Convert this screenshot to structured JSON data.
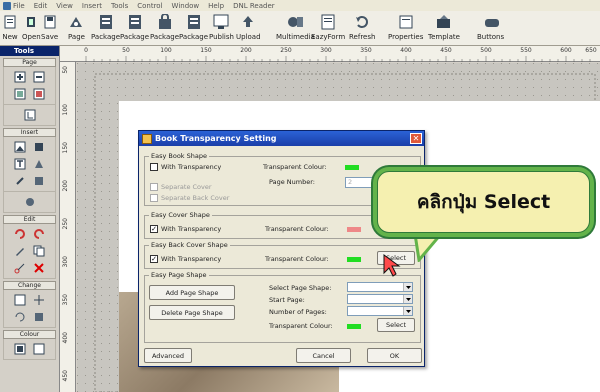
{
  "menu": [
    "File",
    "Edit",
    "View",
    "Insert",
    "Tools",
    "Control",
    "Window",
    "Help",
    "DNL Reader"
  ],
  "toolbar": {
    "items": [
      "New",
      "Open",
      "Save",
      "Page",
      "Package",
      "Package",
      "Package",
      "Package",
      "Publish",
      "Upload",
      "Multimedia",
      "EazyForm",
      "Refresh",
      "Properties",
      "Template",
      "Buttons"
    ]
  },
  "tool_panel": {
    "header": "Tools",
    "sections": [
      "Page",
      "Insert",
      "Edit",
      "Change",
      "Colour"
    ]
  },
  "ruler": {
    "top": [
      "0",
      "50",
      "100",
      "150",
      "200",
      "250",
      "300",
      "350",
      "400",
      "450",
      "500",
      "550",
      "600",
      "650"
    ],
    "left": [
      "50",
      "100",
      "150",
      "200",
      "250",
      "300",
      "350",
      "400",
      "450"
    ]
  },
  "dialog": {
    "title": "Book Transparency Setting",
    "easy_book_shape": {
      "title": "Easy Book Shape",
      "with_transparency": "With Transparency",
      "transparent_colour": "Transparent Colour:",
      "page_number": "Page Number:",
      "page_number_value": "2",
      "separate_cover": "Separate Cover",
      "separate_back_cover": "Separate Back Cover"
    },
    "easy_cover_shape": {
      "title": "Easy Cover Shape",
      "with_transparency": "With Transparency",
      "transparent_colour": "Transparent Colour:"
    },
    "easy_back_cover_shape": {
      "title": "Easy Back Cover Shape",
      "with_transparency": "With Transparency",
      "transparent_colour": "Transparent Colour:",
      "select_button": "Select"
    },
    "easy_page_shape": {
      "title": "Easy Page Shape",
      "add_button": "Add Page Shape",
      "delete_button": "Delete Page Shape",
      "select_page_shape": "Select Page Shape:",
      "start_page": "Start Page:",
      "number_of_pages": "Number of Pages:",
      "transparent_colour": "Transparent Colour:",
      "select_button": "Select"
    },
    "advanced_button": "Advanced",
    "cancel_button": "Cancel",
    "ok_button": "OK"
  },
  "callout": {
    "text": "คลิกปุ่ม Select"
  },
  "colors": {
    "green_swatch": "#22dd22",
    "pink_swatch": "#ee8888",
    "callout_fill": "#f5f0b0",
    "callout_border": "#63b34a"
  }
}
